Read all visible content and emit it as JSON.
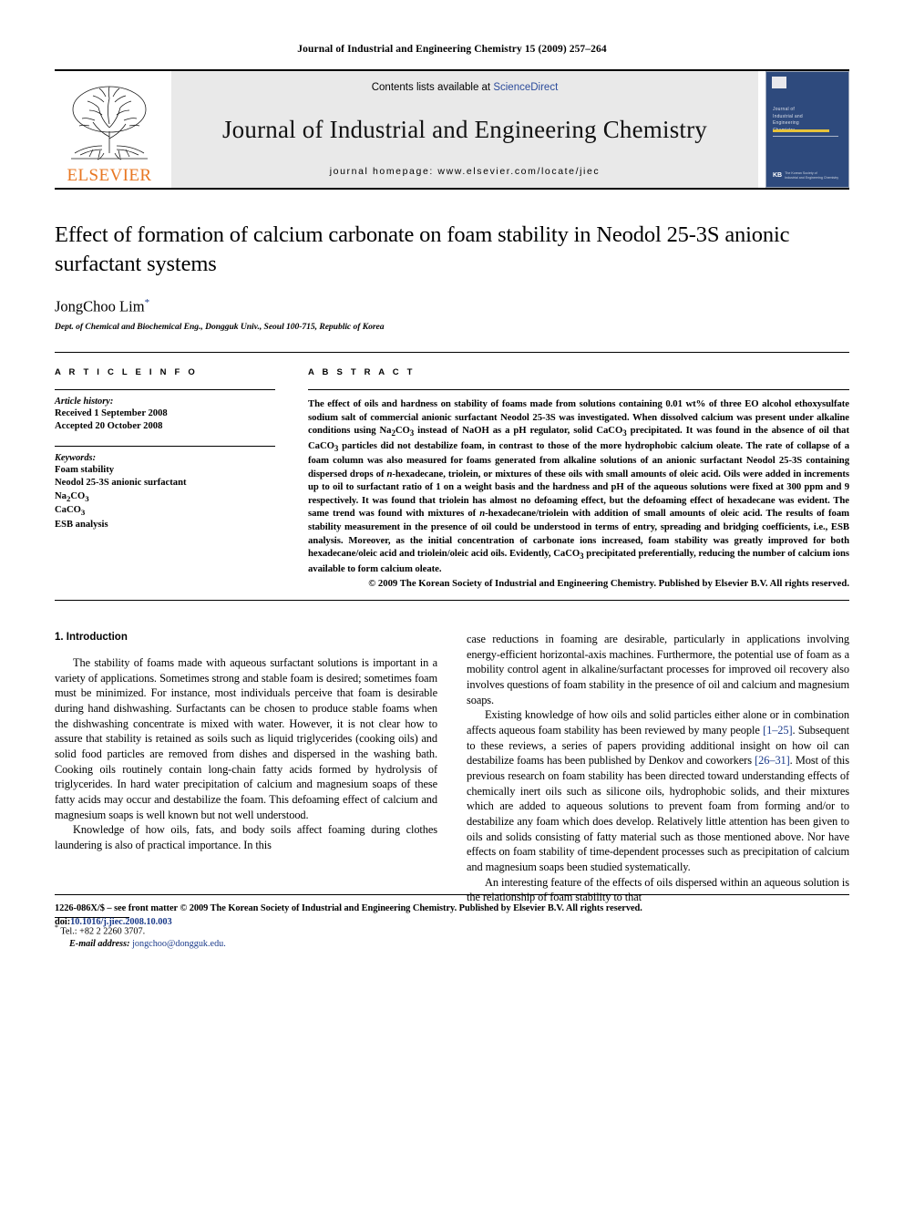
{
  "running_head": "Journal of Industrial and Engineering Chemistry 15 (2009) 257–264",
  "masthead": {
    "contents_prefix": "Contents lists available at ",
    "sciencedirect": "ScienceDirect",
    "journal_title": "Journal of Industrial and Engineering Chemistry",
    "homepage": "journal homepage: www.elsevier.com/locate/jiec",
    "publisher_logo_word": "ELSEVIER",
    "cover_title_lines": "Journal of\nIndustrial and\nEngineering\nChemistry",
    "cover_society": "The Korean Society of\nIndustrial and Engineering Chemistry",
    "cover_kb": "KB"
  },
  "article": {
    "title": "Effect of formation of calcium carbonate on foam stability in Neodol 25-3S anionic surfactant systems",
    "author": "JongChoo Lim",
    "author_marker": "*",
    "affiliation": "Dept. of Chemical and Biochemical Eng., Dongguk Univ., Seoul 100-715, Republic of Korea"
  },
  "article_info": {
    "heading": "A R T I C L E  I N F O",
    "history_label": "Article history:",
    "history": [
      "Received 1 September 2008",
      "Accepted 20 October 2008"
    ],
    "keywords_label": "Keywords:",
    "keywords": [
      "Foam stability",
      "Neodol 25-3S anionic surfactant",
      "Na2CO3",
      "CaCO3",
      "ESB analysis"
    ]
  },
  "abstract": {
    "heading": "A B S T R A C T",
    "text": "The effect of oils and hardness on stability of foams made from solutions containing 0.01 wt% of three EO alcohol ethoxysulfate sodium salt of commercial anionic surfactant Neodol 25-3S was investigated. When dissolved calcium was present under alkaline conditions using Na2CO3 instead of NaOH as a pH regulator, solid CaCO3 precipitated. It was found in the absence of oil that CaCO3 particles did not destabilize foam, in contrast to those of the more hydrophobic calcium oleate. The rate of collapse of a foam column was also measured for foams generated from alkaline solutions of an anionic surfactant Neodol 25-3S containing dispersed drops of n-hexadecane, triolein, or mixtures of these oils with small amounts of oleic acid. Oils were added in increments up to oil to surfactant ratio of 1 on a weight basis and the hardness and pH of the aqueous solutions were fixed at 300 ppm and 9 respectively. It was found that triolein has almost no defoaming effect, but the defoaming effect of hexadecane was evident. The same trend was found with mixtures of n-hexadecane/triolein with addition of small amounts of oleic acid. The results of foam stability measurement in the presence of oil could be understood in terms of entry, spreading and bridging coefficients, i.e., ESB analysis. Moreover, as the initial concentration of carbonate ions increased, foam stability was greatly improved for both hexadecane/oleic acid and triolein/oleic acid oils. Evidently, CaCO3 precipitated preferentially, reducing the number of calcium ions available to form calcium oleate.",
    "copyright": "© 2009 The Korean Society of Industrial and Engineering Chemistry. Published by Elsevier B.V. All rights reserved."
  },
  "introduction": {
    "heading": "1. Introduction",
    "left_paragraphs": [
      "The stability of foams made with aqueous surfactant solutions is important in a variety of applications. Sometimes strong and stable foam is desired; sometimes foam must be minimized. For instance, most individuals perceive that foam is desirable during hand dishwashing. Surfactants can be chosen to produce stable foams when the dishwashing concentrate is mixed with water. However, it is not clear how to assure that stability is retained as soils such as liquid triglycerides (cooking oils) and solid food particles are removed from dishes and dispersed in the washing bath. Cooking oils routinely contain long-chain fatty acids formed by hydrolysis of triglycerides. In hard water precipitation of calcium and magnesium soaps of these fatty acids may occur and destabilize the foam. This defoaming effect of calcium and magnesium soaps is well known but not well understood.",
      "Knowledge of how oils, fats, and body soils affect foaming during clothes laundering is also of practical importance. In this"
    ],
    "right_paragraph_1": "case reductions in foaming are desirable, particularly in applications involving energy-efficient horizontal-axis machines. Furthermore, the potential use of foam as a mobility control agent in alkaline/surfactant processes for improved oil recovery also involves questions of foam stability in the presence of oil and calcium and magnesium soaps.",
    "right_paragraph_2_a": "Existing knowledge of how oils and solid particles either alone or in combination affects aqueous foam stability has been reviewed by many people ",
    "right_ref_1": "[1–25]",
    "right_paragraph_2_b": ". Subsequent to these reviews, a series of papers providing additional insight on how oil can destabilize foams has been published by Denkov and coworkers ",
    "right_ref_2": "[26–31]",
    "right_paragraph_2_c": ". Most of this previous research on foam stability has been directed toward understanding effects of chemically inert oils such as silicone oils, hydrophobic solids, and their mixtures which are added to aqueous solutions to prevent foam from forming and/or to destabilize any foam which does develop. Relatively little attention has been given to oils and solids consisting of fatty material such as those mentioned above. Nor have effects on foam stability of time-dependent processes such as precipitation of calcium and magnesium soaps been studied systematically.",
    "right_paragraph_3": "An interesting feature of the effects of oils dispersed within an aqueous solution is the relationship of foam stability to that"
  },
  "footnote": {
    "marker": "*",
    "tel": "Tel.: +82 2 2260 3707.",
    "email_label": "E-mail address:",
    "email": "jongchoo@dongguk.edu."
  },
  "page_footer": {
    "issn_line": "1226-086X/$ – see front matter © 2009 The Korean Society of Industrial and Engineering Chemistry. Published by Elsevier B.V. All rights reserved.",
    "doi_prefix": "doi:",
    "doi": "10.1016/j.jiec.2008.10.003"
  },
  "colors": {
    "link": "#1b3b8b",
    "elsevier_orange": "#E87722",
    "masthead_bg": "#e9e9e9",
    "cover_blue": "#2e4a7d"
  }
}
